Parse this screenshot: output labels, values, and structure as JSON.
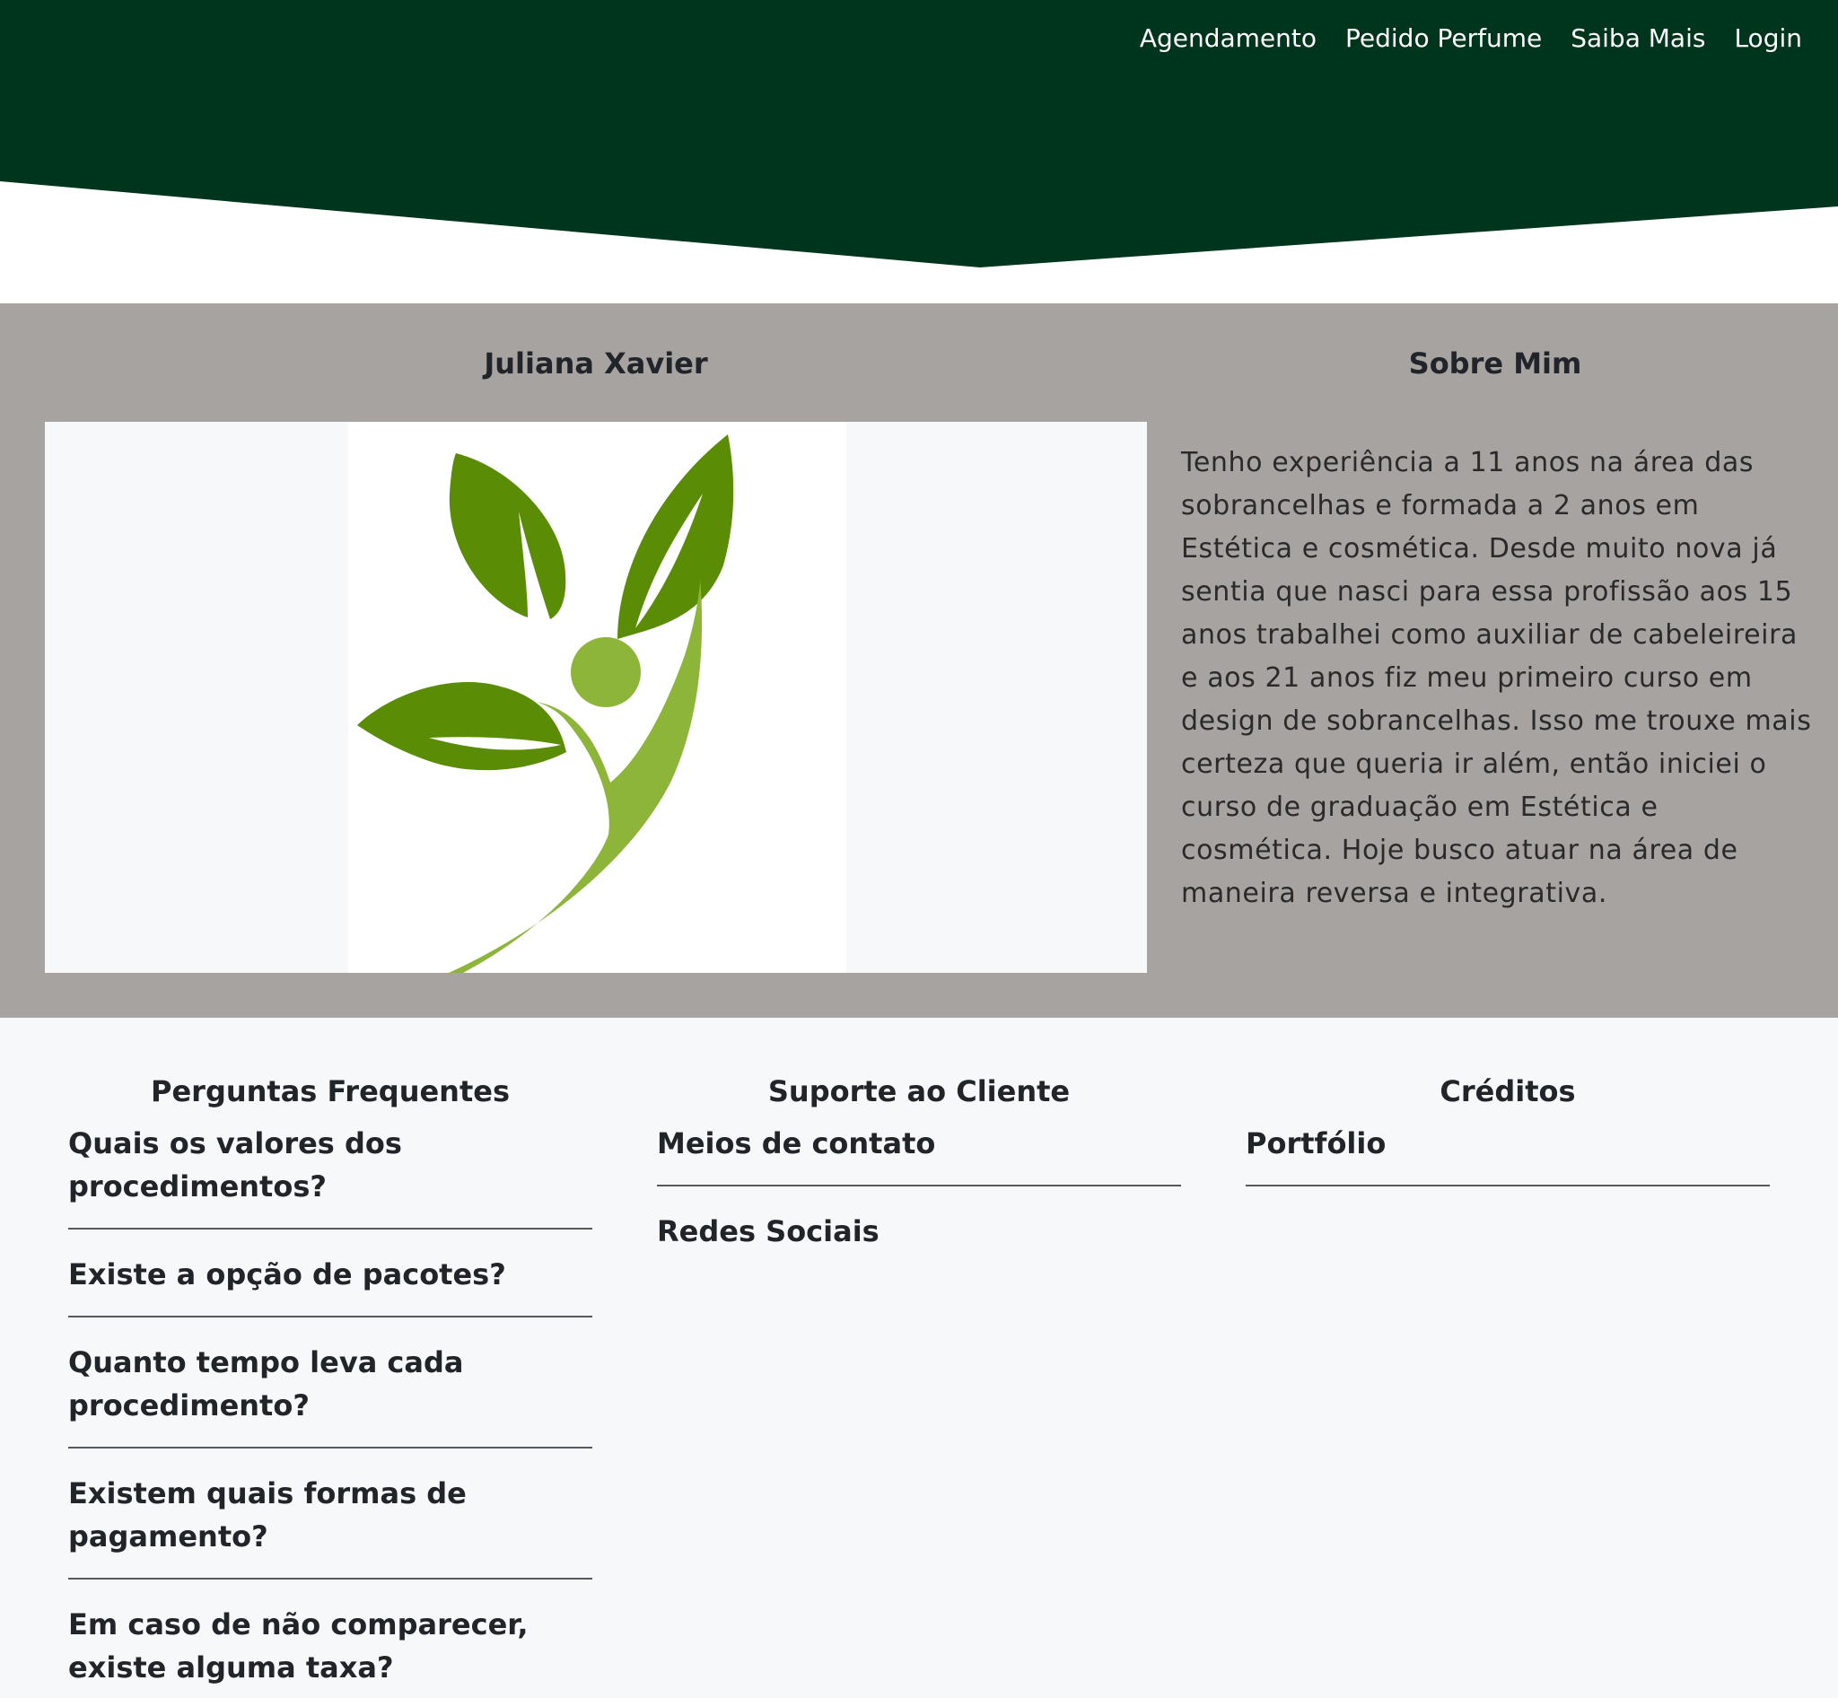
{
  "colors": {
    "header_dark_green": "#00351d",
    "about_background": "#a6a3a1",
    "page_background": "#f7f8fa",
    "leaf_dark_green": "#5a8c05",
    "leaf_light_green": "#8db53a"
  },
  "nav": {
    "items": [
      {
        "label": "Agendamento"
      },
      {
        "label": "Pedido Perfume"
      },
      {
        "label": "Saiba Mais"
      },
      {
        "label": "Login"
      }
    ]
  },
  "about": {
    "name": "Juliana Xavier",
    "heading": "Sobre Mim",
    "logo_icon": "leaf-person-logo-icon",
    "bio": "Tenho experiência a 11 anos na área das sobrancelhas e formada a 2 anos em Estética e cosmética. Desde muito nova já sentia que nasci para essa profissão aos 15 anos trabalhei como auxiliar de cabeleireira e aos 21 anos fiz meu primeiro curso em design de sobrancelhas. Isso me trouxe mais certeza que queria ir além, então iniciei o curso de graduação em Estética e cosmética. Hoje busco atuar na área de maneira reversa e integrativa."
  },
  "footer": {
    "faq": {
      "heading": "Perguntas Frequentes",
      "items": [
        "Quais os valores dos procedimentos?",
        "Existe a opção de pacotes?",
        "Quanto tempo leva cada procedimento?",
        "Existem quais formas de pagamento?",
        "Em caso de não comparecer, existe alguma taxa?"
      ]
    },
    "support": {
      "heading": "Suporte ao Cliente",
      "items": [
        "Meios de contato",
        "Redes Sociais"
      ]
    },
    "credits": {
      "heading": "Créditos",
      "items": [
        "Portfólio"
      ]
    }
  }
}
